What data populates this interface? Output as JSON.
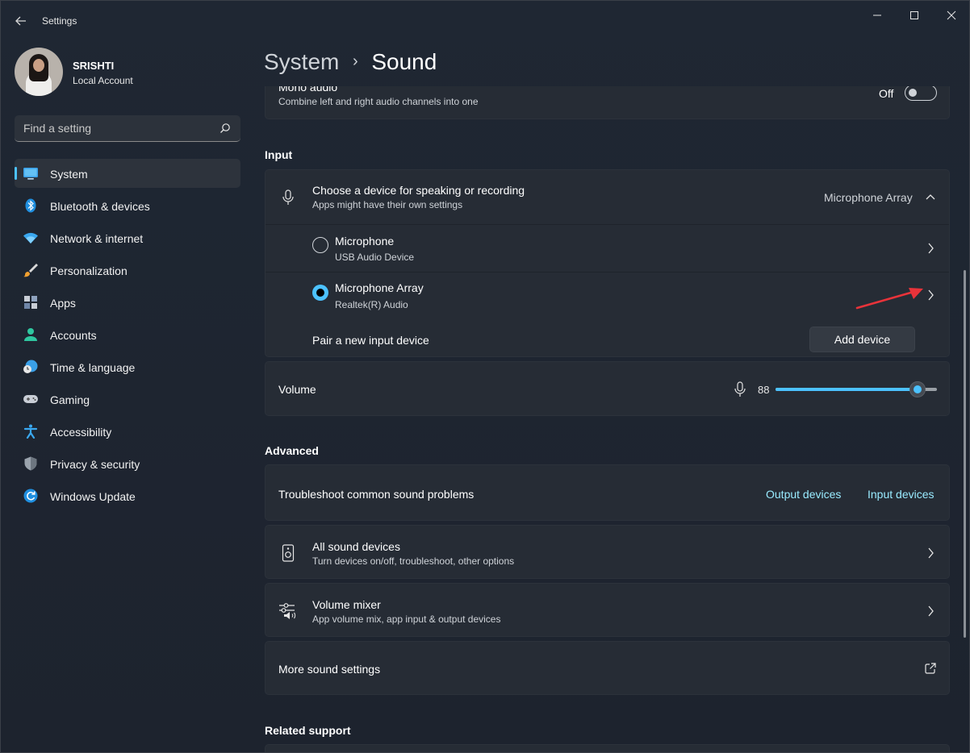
{
  "window": {
    "title": "Settings"
  },
  "profile": {
    "name": "SRISHTI",
    "account_type": "Local Account"
  },
  "search": {
    "placeholder": "Find a setting"
  },
  "sidebar": {
    "items": [
      {
        "label": "System",
        "icon": "monitor-icon",
        "active": true
      },
      {
        "label": "Bluetooth & devices",
        "icon": "bluetooth-icon"
      },
      {
        "label": "Network & internet",
        "icon": "wifi-icon"
      },
      {
        "label": "Personalization",
        "icon": "paintbrush-icon"
      },
      {
        "label": "Apps",
        "icon": "apps-icon"
      },
      {
        "label": "Accounts",
        "icon": "person-icon"
      },
      {
        "label": "Time & language",
        "icon": "globe-clock-icon"
      },
      {
        "label": "Gaming",
        "icon": "gamepad-icon"
      },
      {
        "label": "Accessibility",
        "icon": "accessibility-icon"
      },
      {
        "label": "Privacy & security",
        "icon": "shield-icon"
      },
      {
        "label": "Windows Update",
        "icon": "refresh-icon"
      }
    ]
  },
  "breadcrumb": {
    "parent": "System",
    "separator": "›",
    "current": "Sound"
  },
  "mono_audio": {
    "title": "Mono audio",
    "subtitle": "Combine left and right audio channels into one",
    "state_label": "Off"
  },
  "input": {
    "heading": "Input",
    "choose_device": {
      "title": "Choose a device for speaking or recording",
      "subtitle": "Apps might have their own settings",
      "selected": "Microphone Array"
    },
    "devices": [
      {
        "name": "Microphone",
        "detail": "USB Audio Device",
        "selected": false
      },
      {
        "name": "Microphone Array",
        "detail": "Realtek(R) Audio",
        "selected": true
      }
    ],
    "pair": {
      "label": "Pair a new input device",
      "button": "Add device"
    },
    "volume": {
      "label": "Volume",
      "value": "88",
      "percent": 88
    }
  },
  "advanced": {
    "heading": "Advanced",
    "troubleshoot": {
      "title": "Troubleshoot common sound problems",
      "link_output": "Output devices",
      "link_input": "Input devices"
    },
    "all_devices": {
      "title": "All sound devices",
      "subtitle": "Turn devices on/off, troubleshoot, other options"
    },
    "volume_mixer": {
      "title": "Volume mixer",
      "subtitle": "App volume mix, app input & output devices"
    },
    "more_settings": {
      "title": "More sound settings"
    }
  },
  "related_support": {
    "heading": "Related support"
  },
  "colors": {
    "accent": "#4cc2ff",
    "link": "#99ebff",
    "annotation_arrow": "#e8333a"
  }
}
